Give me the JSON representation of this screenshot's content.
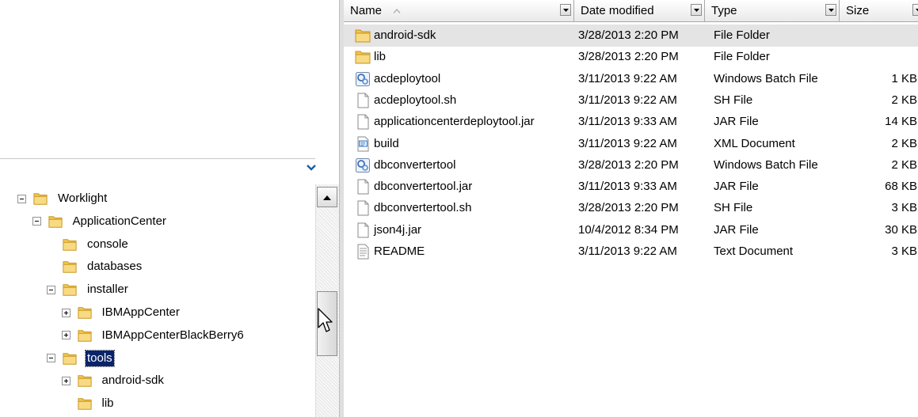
{
  "tree": {
    "items": [
      {
        "label": "Worklight",
        "expander": "minus",
        "indent": 0
      },
      {
        "label": "ApplicationCenter",
        "expander": "minus",
        "indent": 1
      },
      {
        "label": "console",
        "expander": "none",
        "indent": 2
      },
      {
        "label": "databases",
        "expander": "none",
        "indent": 2
      },
      {
        "label": "installer",
        "expander": "minus",
        "indent": 2
      },
      {
        "label": "IBMAppCenter",
        "expander": "plus",
        "indent": 3
      },
      {
        "label": "IBMAppCenterBlackBerry6",
        "expander": "plus",
        "indent": 3
      },
      {
        "label": "tools",
        "expander": "minus",
        "indent": 2,
        "selected": true
      },
      {
        "label": "android-sdk",
        "expander": "plus",
        "indent": 3
      },
      {
        "label": "lib",
        "expander": "none",
        "indent": 3
      }
    ]
  },
  "columns": {
    "name": "Name",
    "date_modified": "Date modified",
    "type": "Type",
    "size": "Size"
  },
  "files": [
    {
      "name": "android-sdk",
      "date": "3/28/2013 2:20 PM",
      "type": "File Folder",
      "size": "",
      "icon": "folder-icon",
      "selected": true
    },
    {
      "name": "lib",
      "date": "3/28/2013 2:20 PM",
      "type": "File Folder",
      "size": "",
      "icon": "folder-icon"
    },
    {
      "name": "acdeploytool",
      "date": "3/11/2013 9:22 AM",
      "type": "Windows Batch File",
      "size": "1 KB",
      "icon": "batch-file-icon"
    },
    {
      "name": "acdeploytool.sh",
      "date": "3/11/2013 9:22 AM",
      "type": "SH File",
      "size": "2 KB",
      "icon": "blank-file-icon"
    },
    {
      "name": "applicationcenterdeploytool.jar",
      "date": "3/11/2013 9:33 AM",
      "type": "JAR File",
      "size": "14 KB",
      "icon": "blank-file-icon"
    },
    {
      "name": "build",
      "date": "3/11/2013 9:22 AM",
      "type": "XML Document",
      "size": "2 KB",
      "icon": "xml-file-icon"
    },
    {
      "name": "dbconvertertool",
      "date": "3/28/2013 2:20 PM",
      "type": "Windows Batch File",
      "size": "2 KB",
      "icon": "batch-file-icon"
    },
    {
      "name": "dbconvertertool.jar",
      "date": "3/11/2013 9:33 AM",
      "type": "JAR File",
      "size": "68 KB",
      "icon": "blank-file-icon"
    },
    {
      "name": "dbconvertertool.sh",
      "date": "3/28/2013 2:20 PM",
      "type": "SH File",
      "size": "3 KB",
      "icon": "blank-file-icon"
    },
    {
      "name": "json4j.jar",
      "date": "10/4/2012 8:34 PM",
      "type": "JAR File",
      "size": "30 KB",
      "icon": "blank-file-icon"
    },
    {
      "name": "README",
      "date": "3/11/2013 9:22 AM",
      "type": "Text Document",
      "size": "3 KB",
      "icon": "text-file-icon"
    }
  ],
  "colors": {
    "selection_highlight": "#0a246a",
    "row_selected": "#e4e4e4",
    "folder": "#f0c550"
  }
}
